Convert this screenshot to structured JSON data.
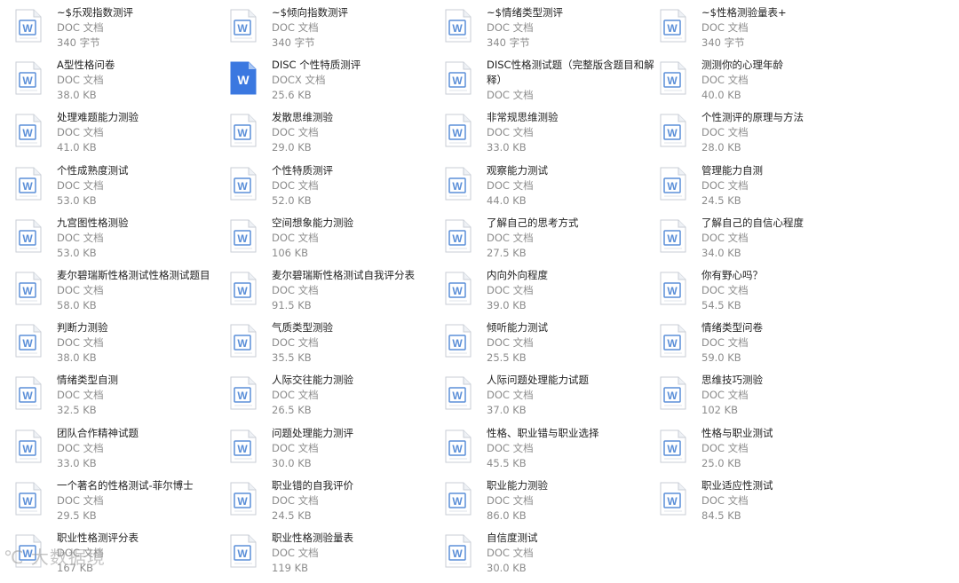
{
  "colors": {
    "doc_icon_border": "#5b8fd8",
    "doc_icon_fill": "#ffffff",
    "docx_icon_fill": "#3b78e0",
    "name_text": "#222222",
    "meta_text": "#8c8c8c"
  },
  "files": [
    {
      "name": "~$乐观指数测评",
      "type": "DOC 文档",
      "size": "340 字节",
      "icon": "doc-word-icon"
    },
    {
      "name": "~$倾向指数测评",
      "type": "DOC 文档",
      "size": "340 字节",
      "icon": "doc-word-icon"
    },
    {
      "name": "~$情绪类型测评",
      "type": "DOC 文档",
      "size": "340 字节",
      "icon": "doc-word-icon"
    },
    {
      "name": "~$性格测验量表+",
      "type": "DOC 文档",
      "size": "340 字节",
      "icon": "doc-word-icon"
    },
    {
      "name": "A型性格问卷",
      "type": "DOC 文档",
      "size": "38.0 KB",
      "icon": "doc-word-icon"
    },
    {
      "name": "DISC 个性特质测评",
      "type": "DOCX 文档",
      "size": "25.6 KB",
      "icon": "docx-word-icon"
    },
    {
      "name": "DISC性格测试题（完整版含题目和解释）",
      "type": "DOC 文档",
      "size": "",
      "icon": "doc-word-icon"
    },
    {
      "name": "测测你的心理年龄",
      "type": "DOC 文档",
      "size": "40.0 KB",
      "icon": "doc-word-icon"
    },
    {
      "name": "处理难题能力测验",
      "type": "DOC 文档",
      "size": "41.0 KB",
      "icon": "doc-word-icon"
    },
    {
      "name": "发散思维测验",
      "type": "DOC 文档",
      "size": "29.0 KB",
      "icon": "doc-word-icon"
    },
    {
      "name": "非常规思维测验",
      "type": "DOC 文档",
      "size": "33.0 KB",
      "icon": "doc-word-icon"
    },
    {
      "name": "个性测评的原理与方法",
      "type": "DOC 文档",
      "size": "28.0 KB",
      "icon": "doc-word-icon"
    },
    {
      "name": "个性成熟度测试",
      "type": "DOC 文档",
      "size": "53.0 KB",
      "icon": "doc-word-icon"
    },
    {
      "name": "个性特质测评",
      "type": "DOC 文档",
      "size": "52.0 KB",
      "icon": "doc-word-icon"
    },
    {
      "name": "观察能力测试",
      "type": "DOC 文档",
      "size": "44.0 KB",
      "icon": "doc-word-icon"
    },
    {
      "name": "管理能力自测",
      "type": "DOC 文档",
      "size": "24.5 KB",
      "icon": "doc-word-icon"
    },
    {
      "name": "九宫图性格测验",
      "type": "DOC 文档",
      "size": "53.0 KB",
      "icon": "doc-word-icon"
    },
    {
      "name": "空间想象能力测验",
      "type": "DOC 文档",
      "size": "106 KB",
      "icon": "doc-word-icon"
    },
    {
      "name": "了解自己的思考方式",
      "type": "DOC 文档",
      "size": "27.5 KB",
      "icon": "doc-word-icon"
    },
    {
      "name": "了解自己的自信心程度",
      "type": "DOC 文档",
      "size": "34.0 KB",
      "icon": "doc-word-icon"
    },
    {
      "name": "麦尔碧瑞斯性格测试性格测试题目",
      "type": "DOC 文档",
      "size": "58.0 KB",
      "icon": "doc-word-icon"
    },
    {
      "name": "麦尔碧瑞斯性格测试自我评分表",
      "type": "DOC 文档",
      "size": "91.5 KB",
      "icon": "doc-word-icon"
    },
    {
      "name": "内向外向程度",
      "type": "DOC 文档",
      "size": "39.0 KB",
      "icon": "doc-word-icon"
    },
    {
      "name": "你有野心吗？",
      "type": "DOC 文档",
      "size": "54.5 KB",
      "icon": "doc-word-icon"
    },
    {
      "name": "判断力测验",
      "type": "DOC 文档",
      "size": "38.0 KB",
      "icon": "doc-word-icon"
    },
    {
      "name": "气质类型测验",
      "type": "DOC 文档",
      "size": "35.5 KB",
      "icon": "doc-word-icon"
    },
    {
      "name": "倾听能力测试",
      "type": "DOC 文档",
      "size": "25.5 KB",
      "icon": "doc-word-icon"
    },
    {
      "name": "情绪类型问卷",
      "type": "DOC 文档",
      "size": "59.0 KB",
      "icon": "doc-word-icon"
    },
    {
      "name": "情绪类型自测",
      "type": "DOC 文档",
      "size": "32.5 KB",
      "icon": "doc-word-icon"
    },
    {
      "name": "人际交往能力测验",
      "type": "DOC 文档",
      "size": "26.5 KB",
      "icon": "doc-word-icon"
    },
    {
      "name": "人际问题处理能力试题",
      "type": "DOC 文档",
      "size": "37.0 KB",
      "icon": "doc-word-icon"
    },
    {
      "name": "思维技巧测验",
      "type": "DOC 文档",
      "size": "102 KB",
      "icon": "doc-word-icon"
    },
    {
      "name": "团队合作精神试题",
      "type": "DOC 文档",
      "size": "33.0 KB",
      "icon": "doc-word-icon"
    },
    {
      "name": "问题处理能力测评",
      "type": "DOC 文档",
      "size": "30.0 KB",
      "icon": "doc-word-icon"
    },
    {
      "name": "性格、职业错与职业选择",
      "type": "DOC 文档",
      "size": "45.5 KB",
      "icon": "doc-word-icon"
    },
    {
      "name": "性格与职业测试",
      "type": "DOC 文档",
      "size": "25.0 KB",
      "icon": "doc-word-icon"
    },
    {
      "name": "一个著名的性格测试-菲尔博士",
      "type": "DOC 文档",
      "size": "29.5 KB",
      "icon": "doc-word-icon"
    },
    {
      "name": "职业错的自我评价",
      "type": "DOC 文档",
      "size": "24.5 KB",
      "icon": "doc-word-icon"
    },
    {
      "name": "职业能力测验",
      "type": "DOC 文档",
      "size": "86.0 KB",
      "icon": "doc-word-icon"
    },
    {
      "name": "职业适应性测试",
      "type": "DOC 文档",
      "size": "84.5 KB",
      "icon": "doc-word-icon"
    },
    {
      "name": "职业性格测评分表",
      "type": "DOC 文档",
      "size": "167 KB",
      "icon": "doc-word-icon"
    },
    {
      "name": "职业性格测验量表",
      "type": "DOC 文档",
      "size": "119 KB",
      "icon": "doc-word-icon"
    },
    {
      "name": "自信度测试",
      "type": "DOC 文档",
      "size": "30.0 KB",
      "icon": "doc-word-icon"
    }
  ],
  "watermark": "℃ 大数据境"
}
